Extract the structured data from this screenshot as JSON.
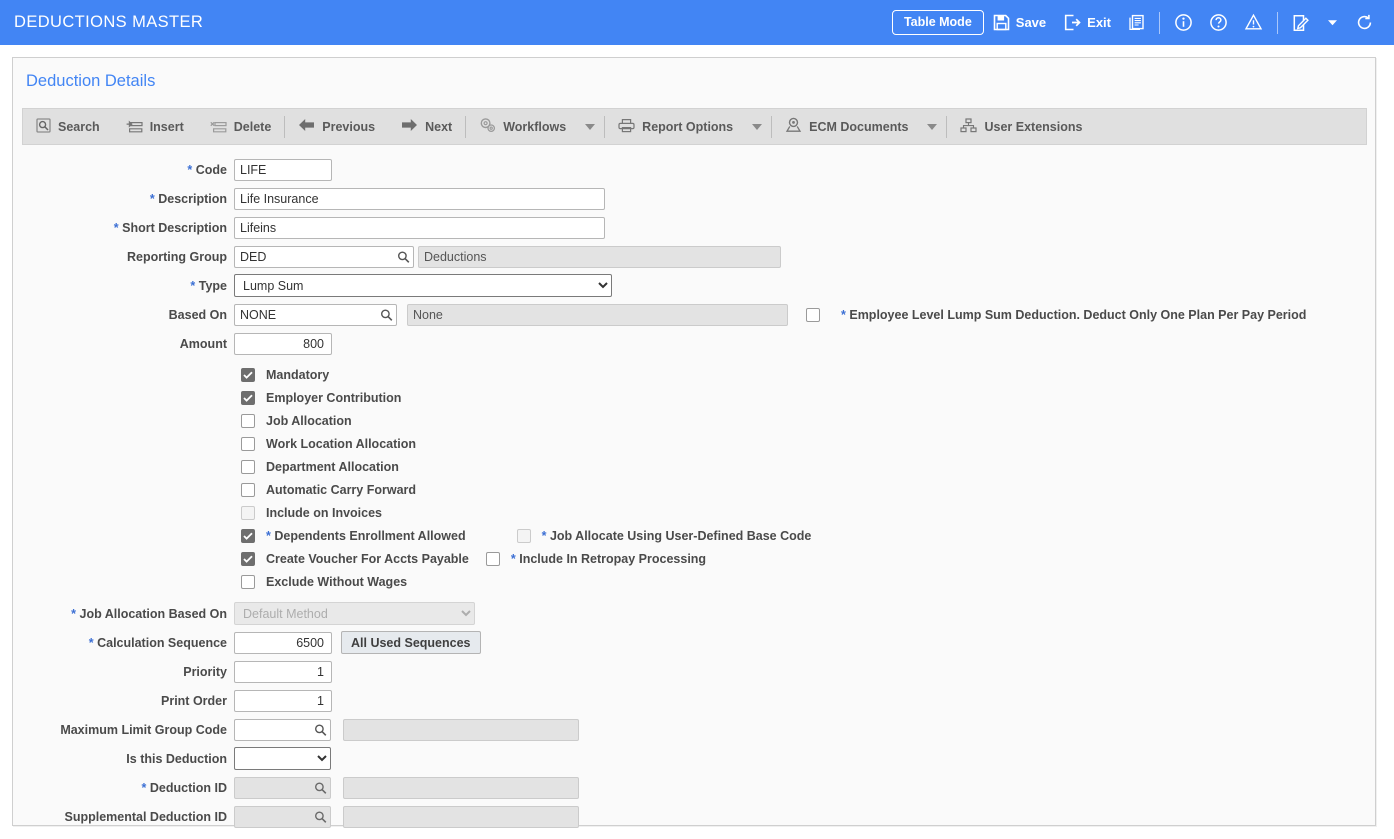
{
  "header": {
    "title": "DEDUCTIONS MASTER",
    "table_mode_label": "Table Mode",
    "save_label": "Save",
    "exit_label": "Exit",
    "accent_color": "#4285f4",
    "icons": [
      "print-icon",
      "info-icon",
      "help-icon",
      "warning-icon",
      "notes-icon",
      "chevron-down-icon",
      "refresh-icon"
    ]
  },
  "card": {
    "title": "Deduction Details"
  },
  "actionbar": {
    "items": [
      {
        "label": "Search",
        "icon": "search-icon",
        "caret": false
      },
      {
        "label": "Insert",
        "icon": "insert-icon",
        "caret": false
      },
      {
        "label": "Delete",
        "icon": "delete-icon",
        "caret": false
      },
      {
        "label": "Previous",
        "icon": "arrow-left-icon",
        "caret": false
      },
      {
        "label": "Next",
        "icon": "arrow-right-icon",
        "caret": false
      },
      {
        "label": "Workflows",
        "icon": "gears-icon",
        "caret": true
      },
      {
        "label": "Report Options",
        "icon": "printer-icon",
        "caret": true
      },
      {
        "label": "ECM Documents",
        "icon": "ecm-icon",
        "caret": true
      },
      {
        "label": "User Extensions",
        "icon": "hierarchy-icon",
        "caret": false
      }
    ]
  },
  "form": {
    "code": {
      "label": "Code",
      "required": true,
      "value": "LIFE"
    },
    "description": {
      "label": "Description",
      "required": true,
      "value": "Life Insurance"
    },
    "short_description": {
      "label": "Short Description",
      "required": true,
      "value": "Lifeins"
    },
    "reporting_group": {
      "label": "Reporting Group",
      "required": false,
      "value": "DED",
      "display": "Deductions"
    },
    "type": {
      "label": "Type",
      "required": true,
      "value": "Lump Sum"
    },
    "based_on": {
      "label": "Based On",
      "required": false,
      "value": "NONE",
      "display": "None"
    },
    "employee_level_note": "* Employee Level Lump Sum Deduction. Deduct Only One Plan Per Pay Period",
    "amount": {
      "label": "Amount",
      "required": false,
      "value": "800"
    },
    "checkboxes": [
      {
        "label": "Mandatory",
        "checked": true,
        "disabled": false,
        "required": false
      },
      {
        "label": "Employer Contribution",
        "checked": true,
        "disabled": false,
        "required": false
      },
      {
        "label": "Job Allocation",
        "checked": false,
        "disabled": false,
        "required": false
      },
      {
        "label": "Work Location Allocation",
        "checked": false,
        "disabled": false,
        "required": false
      },
      {
        "label": "Department Allocation",
        "checked": false,
        "disabled": false,
        "required": false
      },
      {
        "label": "Automatic Carry Forward",
        "checked": false,
        "disabled": false,
        "required": false
      },
      {
        "label": "Include on Invoices",
        "checked": false,
        "disabled": true,
        "required": false
      },
      {
        "label": "Dependents Enrollment Allowed",
        "checked": true,
        "disabled": false,
        "required": true
      },
      {
        "label": "Create Voucher For Accts Payable",
        "checked": true,
        "disabled": false,
        "required": false
      },
      {
        "label": "Exclude Without Wages",
        "checked": false,
        "disabled": false,
        "required": false
      }
    ],
    "checkboxes_right": [
      {
        "label": "Job Allocate Using User-Defined Base Code",
        "checked": false,
        "disabled": true,
        "required": true
      },
      {
        "label": "Include In Retropay Processing",
        "checked": false,
        "disabled": false,
        "required": true
      }
    ],
    "job_allocation_based_on": {
      "label": "Job Allocation Based On",
      "required": true,
      "value": "Default Method",
      "disabled": true
    },
    "calculation_sequence": {
      "label": "Calculation Sequence",
      "required": true,
      "value": "6500",
      "button_label": "All Used Sequences"
    },
    "priority": {
      "label": "Priority",
      "required": false,
      "value": "1"
    },
    "print_order": {
      "label": "Print Order",
      "required": false,
      "value": "1"
    },
    "maximum_limit_group_code": {
      "label": "Maximum Limit Group Code",
      "required": false,
      "value": "",
      "display": ""
    },
    "is_this_deduction": {
      "label": "Is this Deduction",
      "required": false,
      "value": ""
    },
    "deduction_id": {
      "label": "Deduction ID",
      "required": true,
      "value": "",
      "display": "",
      "disabled": true
    },
    "supplemental_deduction_id": {
      "label": "Supplemental Deduction ID",
      "required": false,
      "value": "",
      "display": "",
      "disabled": true
    }
  }
}
